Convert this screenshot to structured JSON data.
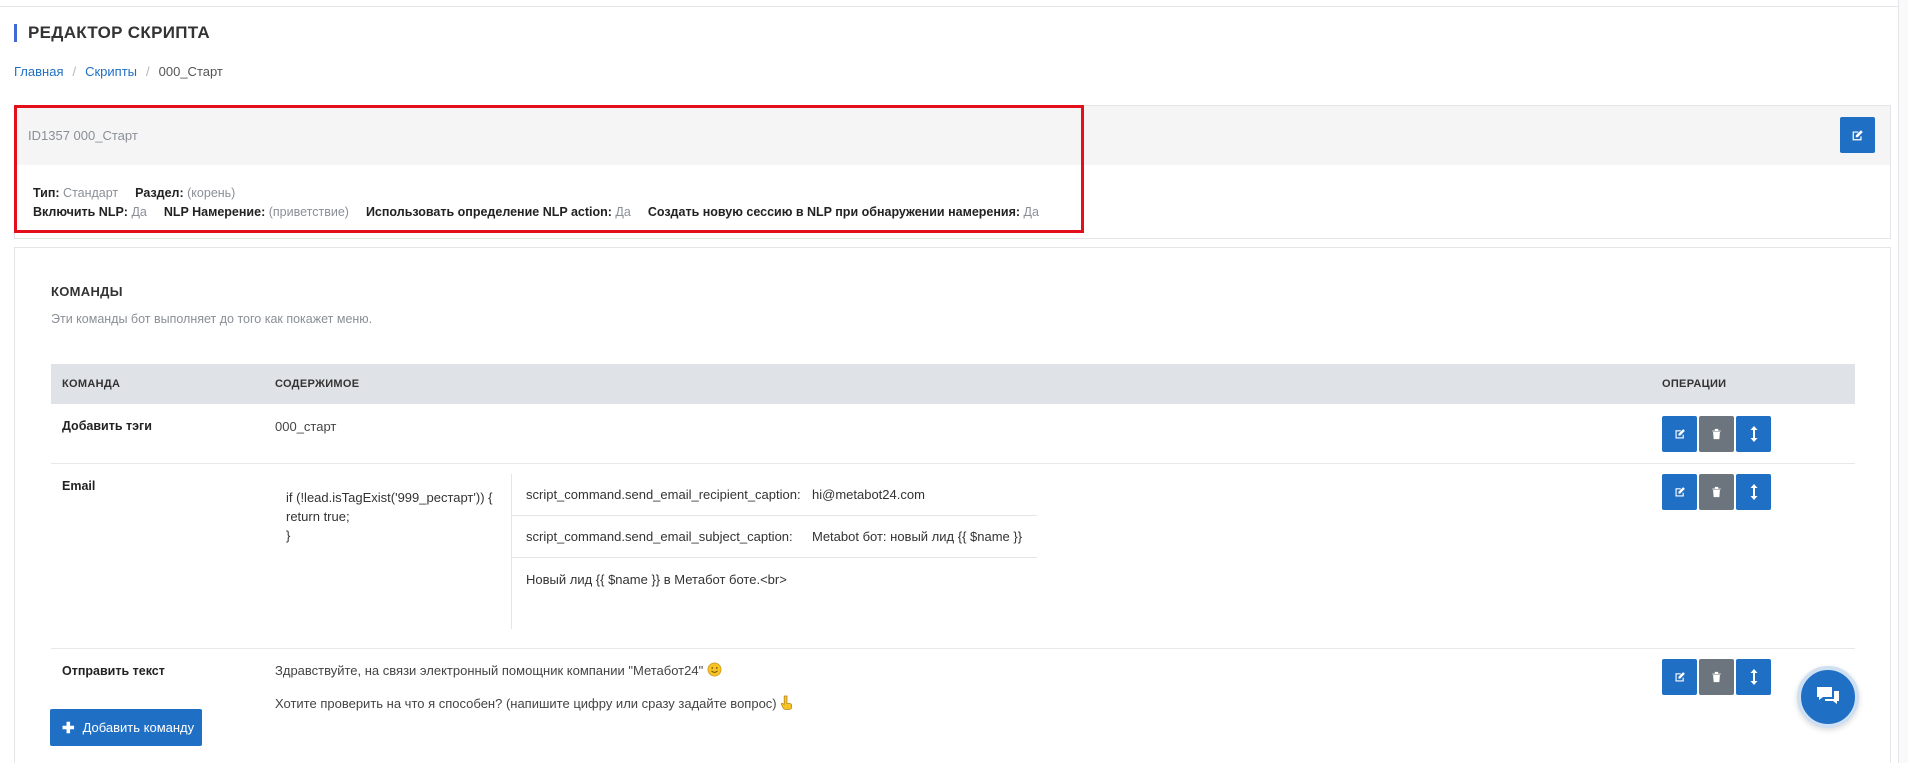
{
  "page": {
    "title": "РЕДАКТОР СКРИПТА"
  },
  "breadcrumb": {
    "home": "Главная",
    "scripts": "Скрипты",
    "current": "000_Старт"
  },
  "script_info": {
    "header": "ID1357 000_Старт",
    "type_label": "Тип:",
    "type_value": "Стандарт",
    "section_label": "Раздел:",
    "section_value": "(корень)",
    "nlp_label": "Включить NLP:",
    "nlp_value": "Да",
    "intent_label": "NLP Намерение:",
    "intent_value": "(приветствие)",
    "action_label": "Использовать определение NLP action:",
    "action_value": "Да",
    "session_label": "Создать новую сессию в NLP при обнаружении намерения:",
    "session_value": "Да"
  },
  "commands": {
    "title": "КОМАНДЫ",
    "subtitle": "Эти команды бот выполняет до того как покажет меню.",
    "columns": {
      "command": "КОМАНДА",
      "content": "СОДЕРЖИМОЕ",
      "operations": "ОПЕРАЦИИ"
    },
    "rows": {
      "tags": {
        "name": "Добавить тэги",
        "content": "000_старт"
      },
      "email": {
        "name": "Email",
        "code_line1": "if (!lead.isTagExist('999_рестарт')) {",
        "code_line2": "return true;",
        "code_line3": "}",
        "recipient_key": "script_command.send_email_recipient_caption:",
        "recipient_value": "hi@metabot24.com",
        "subject_key": "script_command.send_email_subject_caption:",
        "subject_value": "Metabot бот: новый лид {{ $name }}",
        "body": "Новый лид {{ $name }} в Метабот боте.<br>"
      },
      "text": {
        "name": "Отправить текст",
        "line1": "Здравствуйте, на связи электронный помощник компании \"Метабот24\"",
        "line2": "Хотите проверить на что я способен? (напишите цифру или сразу задайте вопрос)"
      }
    },
    "add_button": "Добавить команду"
  },
  "icons": {
    "edit": "edit-icon",
    "delete": "trash-icon",
    "move": "sort-icon",
    "chat": "chat-icon",
    "smile": "smile-emoji",
    "pointing": "pointing-down-emoji"
  },
  "colors": {
    "primary": "#1f6fc5",
    "secondary": "#6c757d",
    "highlight": "#e3101b",
    "accent": "#3f6ad8"
  }
}
